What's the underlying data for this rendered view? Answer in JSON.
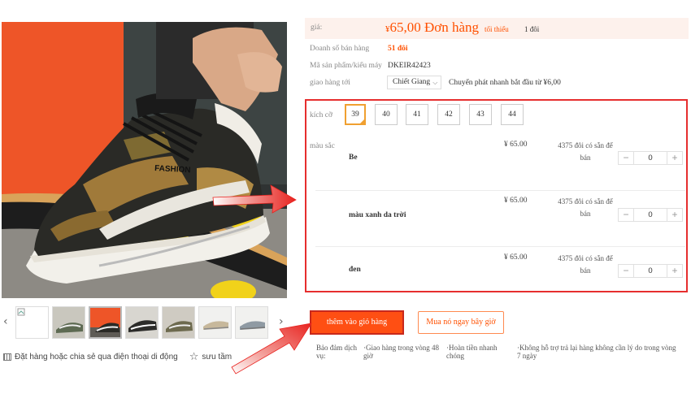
{
  "colors": {
    "accent": "#ff5000",
    "highlight_border": "#e62e2e",
    "cart_button": "#ff4f13",
    "arrow": "#e8231f"
  },
  "price": {
    "label": "giá:",
    "amount": "65,00",
    "currency": "¥",
    "unit_text": "Đơn hàng",
    "min_label": "tối thiểu",
    "min_qty": "1 đôi"
  },
  "sales": {
    "label": "Doanh số bán hàng",
    "value": "51 đôi"
  },
  "model": {
    "label": "Mã sản phẩm/kiểu máy",
    "value": "DKEIR42423"
  },
  "shipping": {
    "label": "giao hàng tới",
    "destination": "Chiết Giang",
    "note": "Chuyển phát nhanh bắt đầu từ ¥6,00"
  },
  "sizes": {
    "label": "kích cỡ",
    "options": [
      "39",
      "40",
      "41",
      "42",
      "43",
      "44"
    ],
    "selected": "39"
  },
  "color_options": {
    "label": "màu sắc",
    "rows": [
      {
        "name": "Be",
        "price": "¥ 65.00",
        "stock": "4375 đôi có sẵn để bán",
        "qty": "0"
      },
      {
        "name": "màu xanh da trời",
        "price": "¥ 65.00",
        "stock": "4375 đôi có sẵn để bán",
        "qty": "0"
      },
      {
        "name": "đen",
        "price": "¥ 65.00",
        "stock": "4375 đôi có sẵn để bán",
        "qty": "0"
      }
    ]
  },
  "actions": {
    "add_to_cart": "thêm vào giỏ hàng",
    "buy_now": "Mua nó ngay bây giờ"
  },
  "guarantees": [
    "Bảo đảm dịch vụ:",
    "·Giao hàng trong vòng 48 giờ",
    "·Hoàn tiền nhanh chóng",
    "·Không hỗ trợ trả lại hàng không cần lý do trong vòng 7 ngày"
  ],
  "share": {
    "mobile_text": "Đặt hàng hoặc chia sẻ qua điện thoại di động",
    "favorite_text": "sưu tầm"
  },
  "shoe_brand_text": "FASHION",
  "icons": [
    "qr-code-icon",
    "star-icon",
    "chevron-down-icon",
    "minus-icon",
    "plus-icon",
    "arrow-left-icon",
    "arrow-right-icon"
  ]
}
